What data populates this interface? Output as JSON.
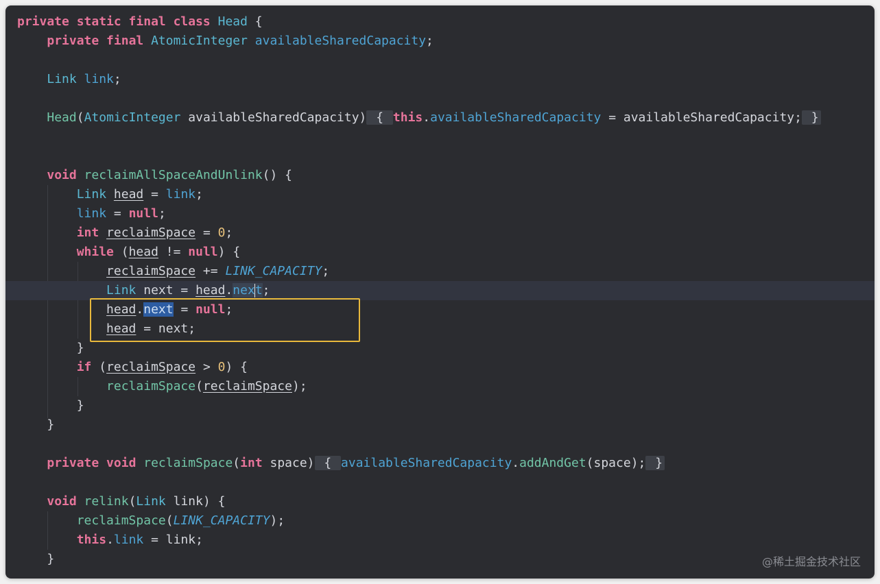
{
  "colors": {
    "background": "#2b2c30",
    "keyword": "#e6749a",
    "type": "#5bb8d2",
    "method": "#72c5a7",
    "field": "#4fa4d4",
    "number": "#e6c07b",
    "highlight_box": "#e8b93c",
    "selection": "#2d5da3"
  },
  "code": {
    "l01": {
      "a": "private static final class ",
      "b": "Head",
      "c": " {"
    },
    "l02": {
      "a": "    ",
      "b": "private final ",
      "c": "AtomicInteger ",
      "d": "availableSharedCapacity",
      "e": ";"
    },
    "l04": {
      "a": "    ",
      "b": "Link ",
      "c": "link",
      "d": ";"
    },
    "l06": {
      "a": "    ",
      "b": "Head",
      "c": "(",
      "d": "AtomicInteger",
      "e": " availableSharedCapacity)",
      "f": " { ",
      "g": "this",
      "h": ".",
      "i": "availableSharedCapacity",
      "j": " = availableSharedCapacity;",
      "k": " }"
    },
    "l09": {
      "a": "    ",
      "b": "void ",
      "c": "reclaimAllSpaceAndUnlink",
      "d": "() {"
    },
    "l10": {
      "a": "        ",
      "b": "Link ",
      "c": "head",
      "d": " = ",
      "e": "link",
      "f": ";"
    },
    "l11": {
      "a": "        ",
      "b": "link",
      "c": " = ",
      "d": "null",
      "e": ";"
    },
    "l12": {
      "a": "        ",
      "b": "int ",
      "c": "reclaimSpace",
      "d": " = ",
      "e": "0",
      "f": ";"
    },
    "l13": {
      "a": "        ",
      "b": "while",
      "c": " (",
      "d": "head",
      "e": " != ",
      "f": "null",
      "g": ") {"
    },
    "l14": {
      "a": "            ",
      "b": "reclaimSpace",
      "c": " += ",
      "d": "LINK_CAPACITY",
      "e": ";"
    },
    "l15": {
      "a": "            ",
      "b": "Link ",
      "c": "next = ",
      "d": "head",
      "e": ".",
      "f": "nex",
      "g": "t",
      "h": ";"
    },
    "l16": {
      "a": "            ",
      "b": "head",
      "c": ".",
      "d": "next",
      "e": " = ",
      "f": "null",
      "g": ";"
    },
    "l17": {
      "a": "            ",
      "b": "head",
      "c": " = next;"
    },
    "l18": {
      "a": "        }"
    },
    "l19": {
      "a": "        ",
      "b": "if",
      "c": " (",
      "d": "reclaimSpace",
      "e": " > ",
      "f": "0",
      "g": ") {"
    },
    "l20": {
      "a": "            ",
      "b": "reclaimSpace",
      "c": "(",
      "d": "reclaimSpace",
      "e": ");"
    },
    "l21": {
      "a": "        }"
    },
    "l22": {
      "a": "    }"
    },
    "l24": {
      "a": "    ",
      "b": "private void ",
      "c": "reclaimSpace",
      "d": "(",
      "e": "int",
      "f": " space)",
      "g": " { ",
      "h": "availableSharedCapacity",
      "i": ".",
      "j": "addAndGet",
      "k": "(space);",
      "l": " }"
    },
    "l26": {
      "a": "    ",
      "b": "void ",
      "c": "relink",
      "d": "(",
      "e": "Link",
      "f": " link) {"
    },
    "l27": {
      "a": "        ",
      "b": "reclaimSpace",
      "c": "(",
      "d": "LINK_CAPACITY",
      "e": ");"
    },
    "l28": {
      "a": "        ",
      "b": "this",
      "c": ".",
      "d": "link",
      "e": " = link;"
    },
    "l29": {
      "a": "    }"
    }
  },
  "watermark": "@稀土掘金技术社区"
}
